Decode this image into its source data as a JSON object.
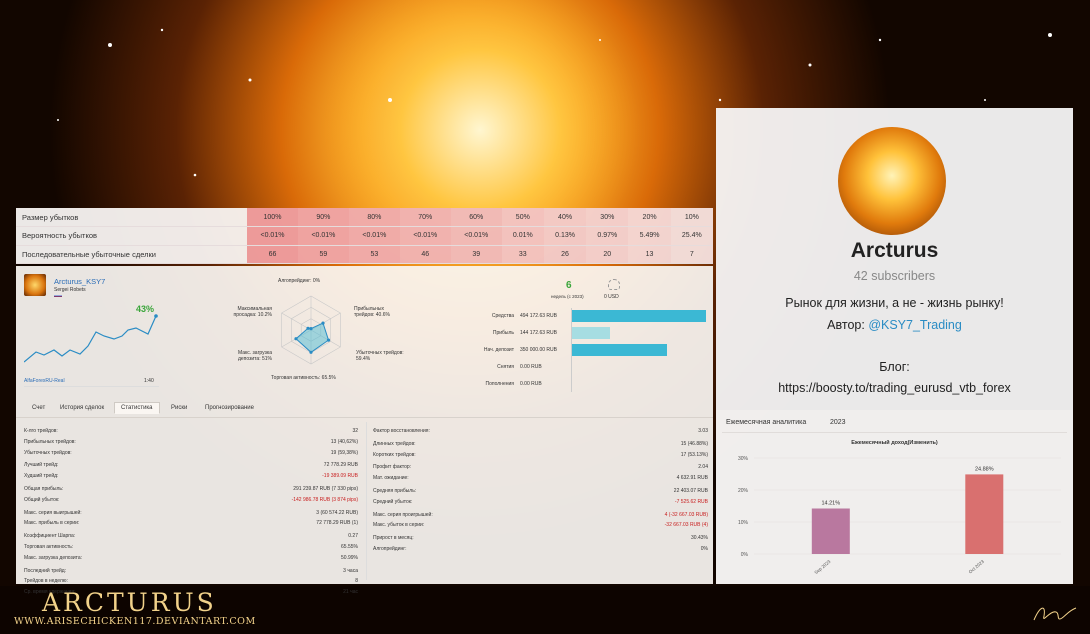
{
  "loss_table": {
    "rows": [
      {
        "label": "Размер убытков",
        "cells": [
          "100%",
          "90%",
          "80%",
          "70%",
          "60%",
          "50%",
          "40%",
          "30%",
          "20%",
          "10%"
        ]
      },
      {
        "label": "Вероятность убытков",
        "cells": [
          "<0.01%",
          "<0.01%",
          "<0.01%",
          "<0.01%",
          "<0.01%",
          "0.01%",
          "0.13%",
          "0.97%",
          "5.49%",
          "25.4%"
        ]
      },
      {
        "label": "Последовательные убыточные сделки",
        "cells": [
          "66",
          "59",
          "53",
          "46",
          "39",
          "33",
          "26",
          "20",
          "13",
          "7"
        ]
      }
    ]
  },
  "account": {
    "name": "Arcturus_KSY7",
    "owner": "Sergei Robets",
    "growth": "43%",
    "server": "AlfaForexRU-Real",
    "leverage": "1:40",
    "radar_labels": {
      "algo": "Алгопрейдинг: 0%",
      "profit": "Прибыльных трейдов: 40.6%",
      "loss": "Убыточных трейдов: 59.4%",
      "activity": "Торговая активность: 65.5%",
      "load": "Макс. загрузка депозита: 51%",
      "drawdown": "Максимальная просадка: 10.2%"
    },
    "radar_values": [
      0,
      40.6,
      59.4,
      65.5,
      51,
      10.2
    ],
    "weeks": "6",
    "weeks_label": "недель (с 2023)",
    "subscribers_value": "0 USD",
    "bars": [
      {
        "label": "Средства",
        "value": "494 172.63 RUB",
        "fraction": 1.0
      },
      {
        "label": "Прибыль",
        "value": "144 172.63 RUB",
        "fraction": 0.29
      },
      {
        "label": "Нач. депозит",
        "value": "350 000.00 RUB",
        "fraction": 0.71
      },
      {
        "label": "Снятия",
        "value": "0.00 RUB",
        "fraction": 0
      },
      {
        "label": "Пополнения",
        "value": "0.00 RUB",
        "fraction": 0
      }
    ],
    "tabs": [
      "Счет",
      "История сделок",
      "Статистика",
      "Риски",
      "Прогнозирование"
    ],
    "active_tab": "Статистика",
    "stats_left": [
      {
        "k": "К-лго трейдов:",
        "v": "32"
      },
      {
        "k": "Прибыльных трейдов:",
        "v": "13 (40,62%)"
      },
      {
        "k": "Убыточных трейдов:",
        "v": "19 (59,38%)"
      },
      {
        "k": "Лучший трейд:",
        "v": "72 778.29 RUB"
      },
      {
        "k": "Худший трейд:",
        "v": "-19 389.09 RUB",
        "red": true
      },
      {
        "k": "Общая прибыль:",
        "v": "291 239.87 RUB (7 330 pips)"
      },
      {
        "k": "Общий убыток:",
        "v": "-142 986.78 RUB (3 874 pips)",
        "red": true
      },
      {
        "k": "Макс. серия выигрышей:",
        "v": "3 (60 574.22 RUB)"
      },
      {
        "k": "Макс. прибыль в серии:",
        "v": "72 778.29 RUB (1)"
      },
      {
        "k": "Коэффициент Шарпа:",
        "v": "0.27"
      },
      {
        "k": "Торговая активность:",
        "v": "65.55%"
      },
      {
        "k": "Макс. загрузка депозита:",
        "v": "50.99%"
      },
      {
        "k": "Последний трейд:",
        "v": "3 часа"
      },
      {
        "k": "Трейдов в неделю:",
        "v": "8"
      },
      {
        "k": "Ср. время удержания:",
        "v": "21 час"
      }
    ],
    "stats_right": [
      {
        "k": "Фактор восстановления:",
        "v": "3.03"
      },
      {
        "k": "Длинных трейдов:",
        "v": "15 (46.88%)"
      },
      {
        "k": "Коротких трейдов:",
        "v": "17 (53.13%)"
      },
      {
        "k": "Профит фактор:",
        "v": "2.04"
      },
      {
        "k": "Мат. ожидание:",
        "v": "4 632.91 RUB"
      },
      {
        "k": "Средняя прибыль:",
        "v": "22 403.07 RUB"
      },
      {
        "k": "Средний убыток:",
        "v": "-7 525.62 RUB",
        "red": true
      },
      {
        "k": "Макс. серия проигрышей:",
        "v": "4 (-32 667.03 RUB)",
        "red": true
      },
      {
        "k": "Макс. убыток в серии:",
        "v": "-32 667.03 RUB (4)",
        "red": true
      },
      {
        "k": "Прирост в месяц:",
        "v": "30.43%"
      },
      {
        "k": "Алгопрейдинг:",
        "v": "0%"
      }
    ]
  },
  "channel": {
    "name": "Arcturus",
    "subscribers": "42 subscribers",
    "motto": "Рынок для жизни, а не - жизнь рынку!",
    "author_label": "Автор:",
    "author_handle": "@KSY7_Trading",
    "blog_label": "Блог:",
    "blog_url": "https://boosty.to/trading_eurusd_vtb_forex"
  },
  "analytics": {
    "title": "Ежемесячная аналитика",
    "year": "2023",
    "chart_data": {
      "type": "bar",
      "title": "Ежемесячный доход(Изменить)",
      "categories": [
        "Sep 2023",
        "Oct 2023"
      ],
      "values": [
        14.21,
        24.88
      ],
      "data_labels": [
        "14.21%",
        "24.88%"
      ],
      "ylim": [
        0,
        30
      ],
      "yticks": [
        "0%",
        "10%",
        "20%",
        "30%"
      ],
      "colors": [
        "#b9789f",
        "#d9706f"
      ],
      "grid": true
    }
  },
  "watermark": {
    "title": "Arcturus",
    "site": "www.arisechicken117.deviantart.com"
  },
  "colors": {
    "bar": "#3bb8d4",
    "bar_light": "#a6dde2",
    "accent_green": "#3aa53a",
    "loss_red": "#f2b8b8",
    "link": "#2a8cc4"
  }
}
